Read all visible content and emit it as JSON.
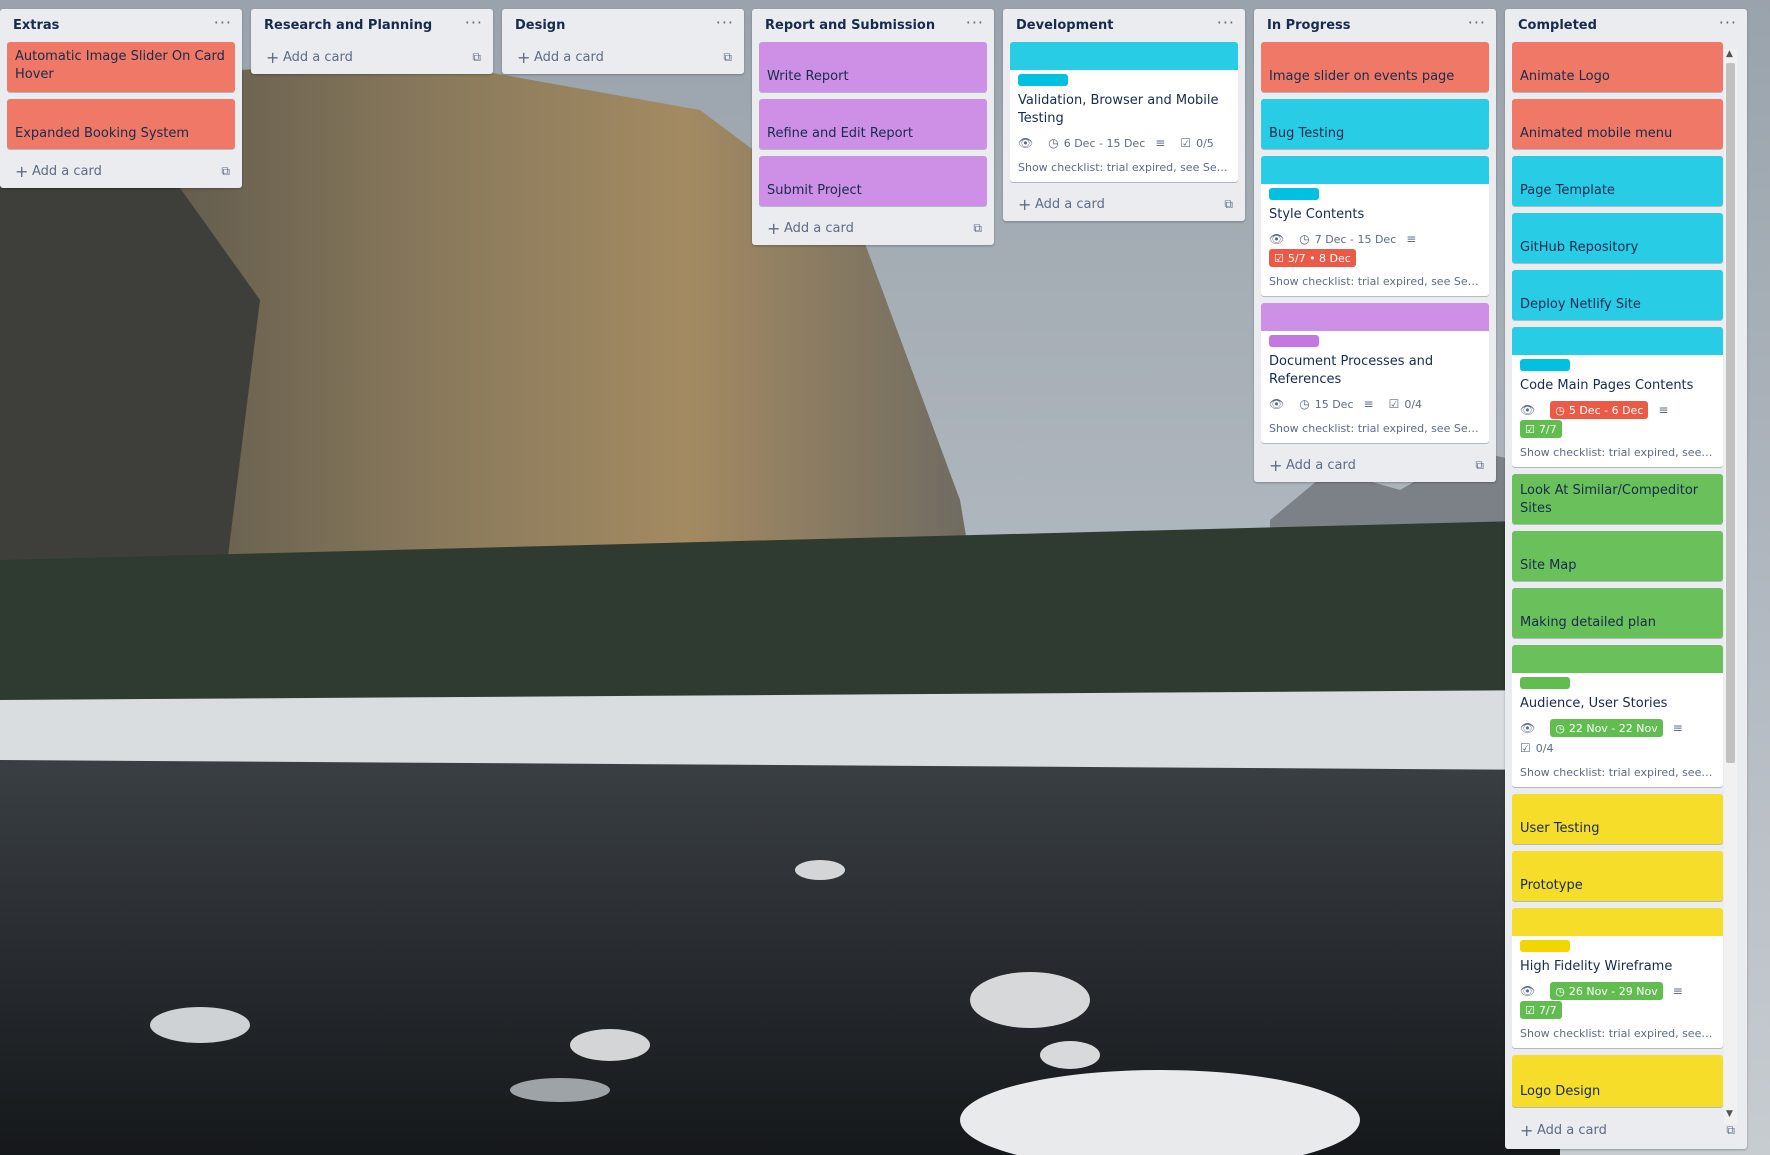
{
  "lists": [
    {
      "title": "Extras",
      "menu": "···",
      "add_card": "Add a card",
      "cards": [
        "Automatic Image Slider On Card Hover",
        "Expanded Booking System"
      ]
    },
    {
      "title": "Research and Planning",
      "menu": "···",
      "add_card": "Add a card",
      "cards": []
    },
    {
      "title": "Design",
      "menu": "···",
      "add_card": "Add a card",
      "cards": []
    },
    {
      "title": "Report and Submission",
      "menu": "···",
      "add_card": "Add a card",
      "cards": [
        "Write Report",
        "Refine and Edit Report",
        "Submit Project"
      ]
    },
    {
      "title": "Development",
      "menu": "···",
      "add_card": "Add a card",
      "detail_card": {
        "title": "Validation, Browser and Mobile Testing",
        "dates": "6 Dec - 15 Dec",
        "checklist": "0/5",
        "show_checklist": "Show checklist: trial expired, see Settin..."
      }
    },
    {
      "title": "In Progress",
      "menu": "···",
      "add_card": "Add a card",
      "cards": [
        "Image slider on events page",
        "Bug Testing"
      ],
      "detail_cards": [
        {
          "title": "Style Contents",
          "dates": "7 Dec - 15 Dec",
          "overdue": "5/7 • 8 Dec",
          "show_checklist": "Show checklist: trial expired, see Settin..."
        },
        {
          "title": "Document Processes and References",
          "dates": "15 Dec",
          "checklist": "0/4",
          "show_checklist": "Show checklist: trial expired, see Settin..."
        }
      ]
    },
    {
      "title": "Completed",
      "menu": "···",
      "add_card": "Add a card",
      "cards_top": [
        "Animate Logo",
        "Animated mobile menu",
        "Page Template",
        "GitHub Repository",
        "Deploy Netlify Site"
      ],
      "code_card": {
        "title": "Code Main Pages Contents",
        "dates": "5 Dec - 6 Dec",
        "checklist": "7/7",
        "show_checklist": "Show checklist: trial expired, see Set..."
      },
      "cards_green": [
        "Look At Similar/Compeditor Sites",
        "Site Map",
        "Making detailed plan"
      ],
      "audience_card": {
        "title": "Audience, User Stories",
        "dates": "22 Nov - 22 Nov",
        "checklist": "0/4",
        "show_checklist": "Show checklist: trial expired, see Set..."
      },
      "cards_yellow": [
        "User Testing",
        "Prototype"
      ],
      "hfw_card": {
        "title": "High Fidelity Wireframe",
        "dates": "26 Nov - 29 Nov",
        "checklist": "7/7",
        "show_checklist": "Show checklist: trial expired, see Set..."
      },
      "last_card": "Logo Design"
    }
  ],
  "colors": {
    "orange": "#f07866",
    "cyan": "#29cce5",
    "purple": "#ce8fe6",
    "green": "#6ac15b",
    "yellow": "#f5dd29",
    "list_bg": "#ebecf0"
  },
  "icons": {
    "eye": "eye-icon",
    "clock": "clock-icon",
    "description": "description-icon",
    "checklist": "checklist-icon",
    "plus": "plus-icon",
    "template": "card-template-icon",
    "menu": "list-menu-icon"
  }
}
